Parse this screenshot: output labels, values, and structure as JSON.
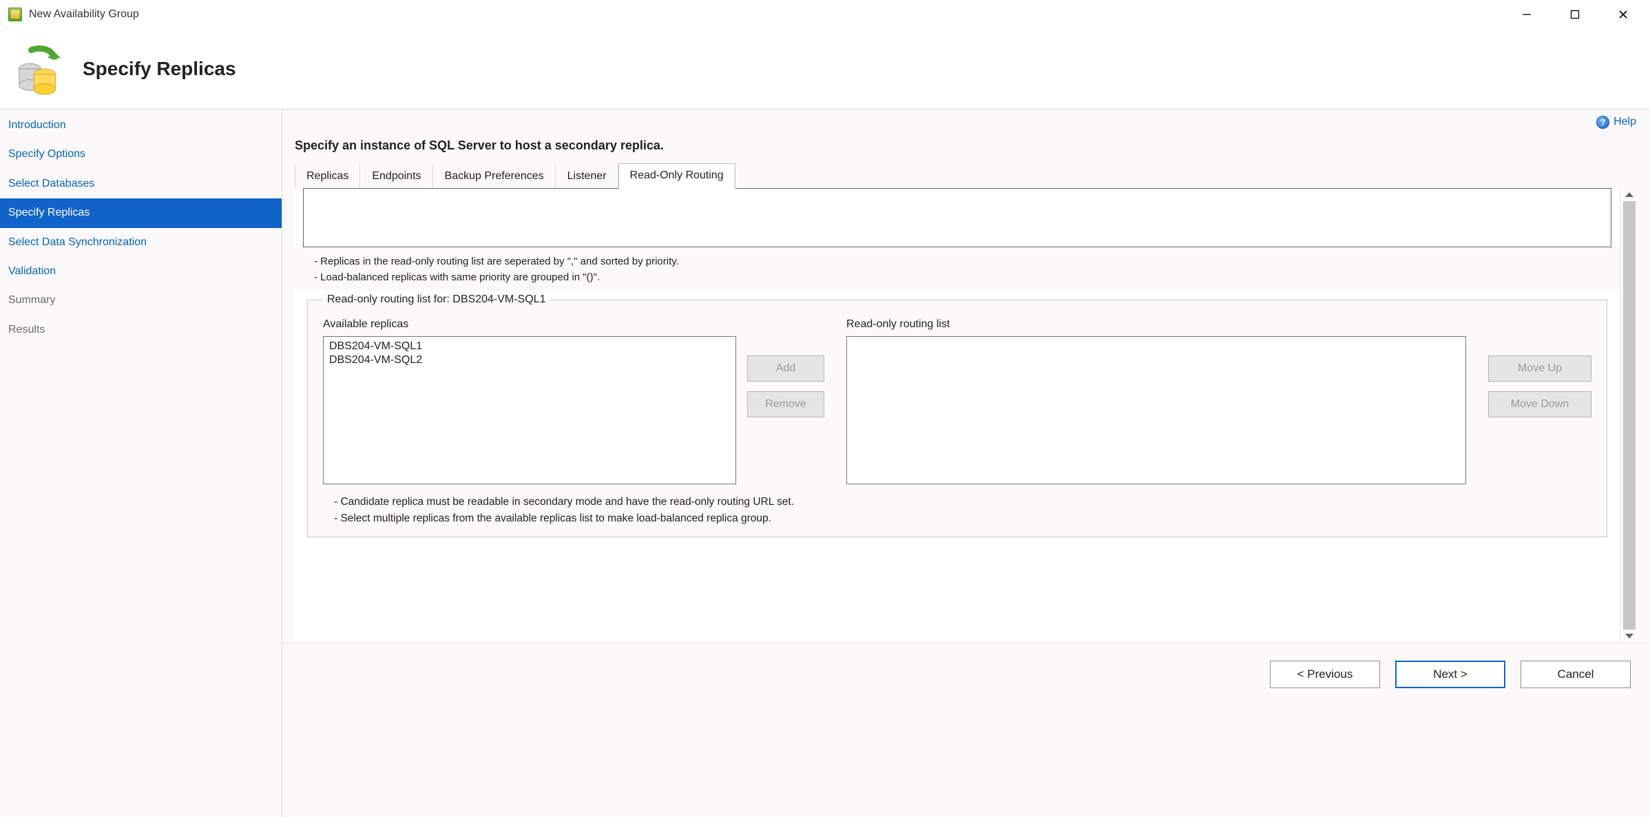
{
  "window": {
    "title": "New Availability Group"
  },
  "header": {
    "page_title": "Specify Replicas"
  },
  "sidebar": {
    "items": [
      {
        "label": "Introduction",
        "state": "link"
      },
      {
        "label": "Specify Options",
        "state": "link"
      },
      {
        "label": "Select Databases",
        "state": "link"
      },
      {
        "label": "Specify Replicas",
        "state": "active"
      },
      {
        "label": "Select Data Synchronization",
        "state": "link"
      },
      {
        "label": "Validation",
        "state": "link"
      },
      {
        "label": "Summary",
        "state": "muted"
      },
      {
        "label": "Results",
        "state": "muted"
      }
    ]
  },
  "help": {
    "label": "Help"
  },
  "subtitle": "Specify an instance of SQL Server to host a secondary replica.",
  "tabs": [
    {
      "label": "Replicas",
      "active": false
    },
    {
      "label": "Endpoints",
      "active": false
    },
    {
      "label": "Backup Preferences",
      "active": false
    },
    {
      "label": "Listener",
      "active": false
    },
    {
      "label": "Read-Only Routing",
      "active": true
    }
  ],
  "top_notes": {
    "line1": "- Replicas in the read-only routing list are seperated by \",\" and sorted by priority.",
    "line2": "- Load-balanced replicas with same priority are grouped in \"()\"."
  },
  "routing": {
    "legend": "Read-only routing list for: DBS204-VM-SQL1",
    "available_label": "Available replicas",
    "routing_label": "Read-only routing list",
    "available": [
      "DBS204-VM-SQL1",
      "DBS204-VM-SQL2"
    ],
    "routing_list": [],
    "buttons": {
      "add": "Add",
      "remove": "Remove",
      "move_up": "Move Up",
      "move_down": "Move Down"
    }
  },
  "bottom_notes": {
    "line1": "- Candidate replica must be readable in secondary mode and have the read-only routing URL set.",
    "line2": "- Select multiple replicas from the available replicas list to make load-balanced replica group."
  },
  "footer": {
    "previous": "< Previous",
    "next": "Next >",
    "cancel": "Cancel"
  }
}
